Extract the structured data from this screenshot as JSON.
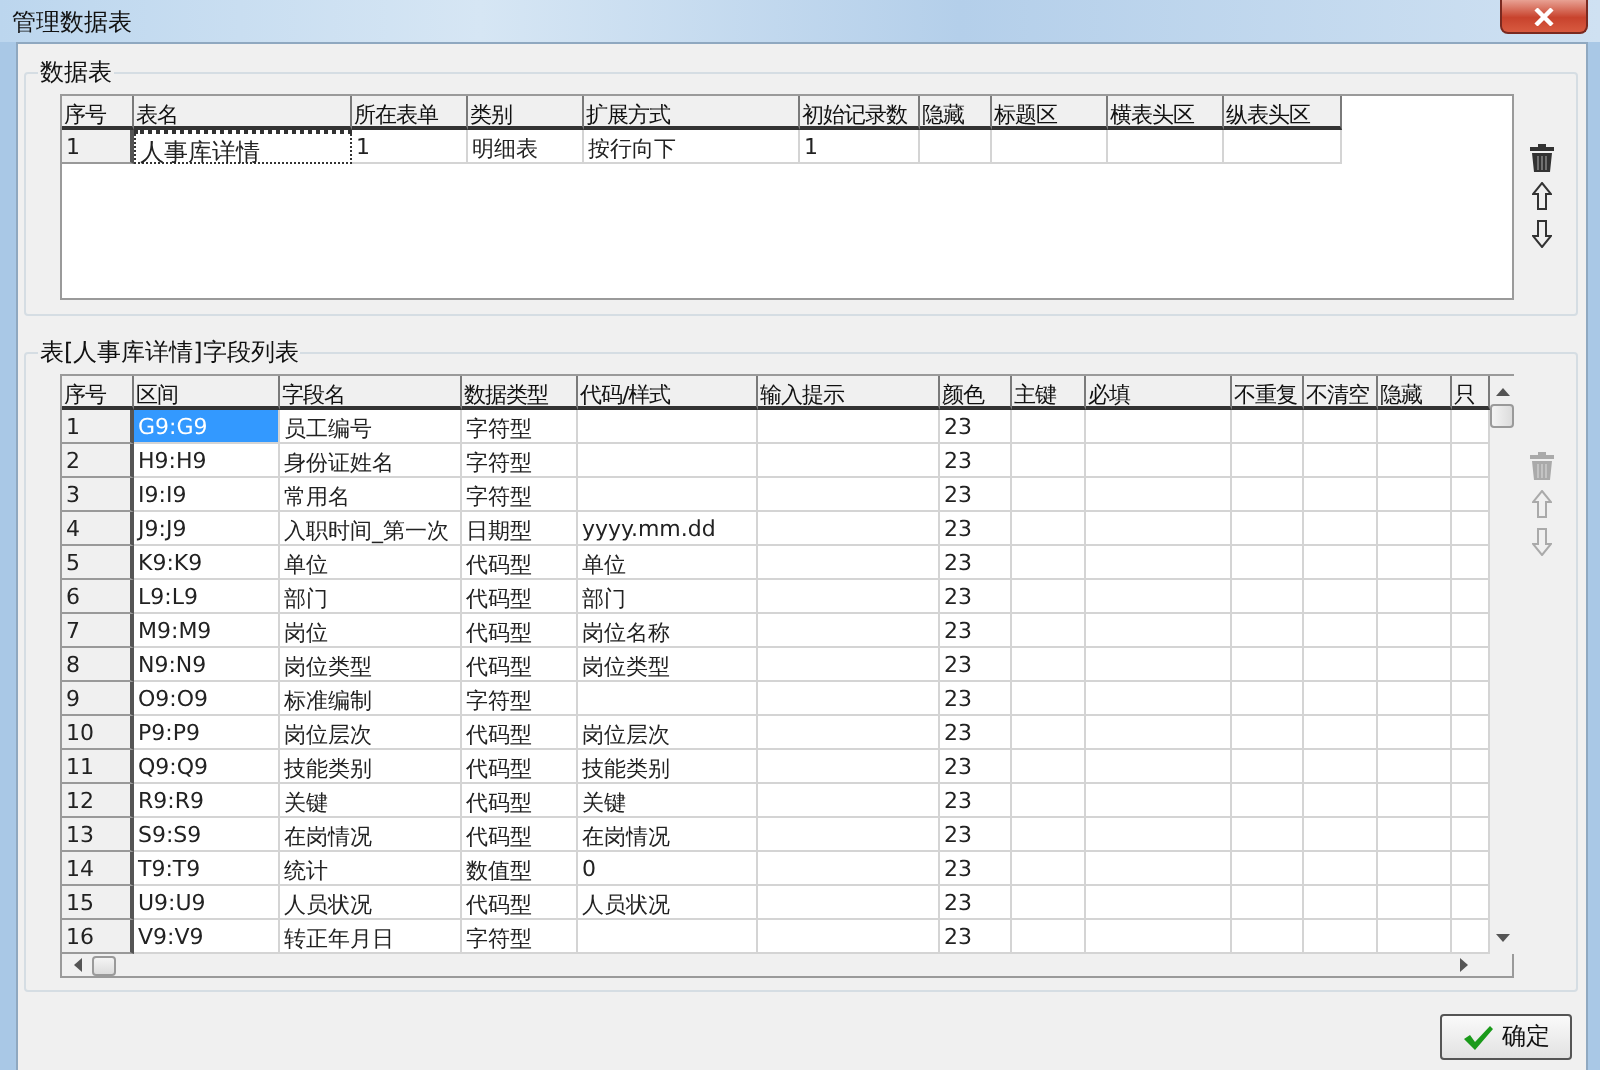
{
  "window": {
    "title": "管理数据表"
  },
  "data_table": {
    "title": "数据表",
    "columns": [
      "序号",
      "表名",
      "所在表单",
      "类别",
      "扩展方式",
      "初始记录数",
      "隐藏",
      "标题区",
      "横表头区",
      "纵表头区"
    ],
    "rows": [
      {
        "no": "1",
        "name": "人事库详情",
        "form": "1",
        "category": "明细表",
        "expand": "按行向下",
        "initial_count": "1",
        "selected": true
      }
    ]
  },
  "data_table_tools": [
    {
      "kind": "delete",
      "disabled": false
    },
    {
      "kind": "up",
      "disabled": false
    },
    {
      "kind": "down",
      "disabled": false
    }
  ],
  "field_table": {
    "title": "表[人事库详情]字段列表",
    "columns": [
      "序号",
      "区间",
      "字段名",
      "数据类型",
      "代码/样式",
      "输入提示",
      "颜色",
      "主键",
      "必填",
      "不重复",
      "不清空",
      "隐藏",
      "只"
    ],
    "rows": [
      {
        "no": "1",
        "range": "G9:G9",
        "name": "员工编号",
        "type": "字符型",
        "color_no": "23",
        "selected": true
      },
      {
        "no": "2",
        "range": "H9:H9",
        "name": "身份证姓名",
        "type": "字符型",
        "color_no": "23",
        "selected": false
      },
      {
        "no": "3",
        "range": "I9:I9",
        "name": "常用名",
        "type": "字符型",
        "color_no": "23",
        "selected": false
      },
      {
        "no": "4",
        "range": "J9:J9",
        "name": "入职时间_第一次",
        "type": "日期型",
        "code": "yyyy.mm.dd",
        "color_no": "23",
        "selected": false
      },
      {
        "no": "5",
        "range": "K9:K9",
        "name": "单位",
        "type": "代码型",
        "code": "单位",
        "color_no": "23",
        "selected": false
      },
      {
        "no": "6",
        "range": "L9:L9",
        "name": "部门",
        "type": "代码型",
        "code": "部门",
        "color_no": "23",
        "selected": false
      },
      {
        "no": "7",
        "range": "M9:M9",
        "name": "岗位",
        "type": "代码型",
        "code": "岗位名称",
        "color_no": "23",
        "selected": false
      },
      {
        "no": "8",
        "range": "N9:N9",
        "name": "岗位类型",
        "type": "代码型",
        "code": "岗位类型",
        "color_no": "23",
        "selected": false
      },
      {
        "no": "9",
        "range": "O9:O9",
        "name": "标准编制",
        "type": "字符型",
        "color_no": "23",
        "selected": false
      },
      {
        "no": "10",
        "range": "P9:P9",
        "name": "岗位层次",
        "type": "代码型",
        "code": "岗位层次",
        "color_no": "23",
        "selected": false
      },
      {
        "no": "11",
        "range": "Q9:Q9",
        "name": "技能类别",
        "type": "代码型",
        "code": "技能类别",
        "color_no": "23",
        "selected": false
      },
      {
        "no": "12",
        "range": "R9:R9",
        "name": "关键",
        "type": "代码型",
        "code": "关键",
        "color_no": "23",
        "selected": false
      },
      {
        "no": "13",
        "range": "S9:S9",
        "name": "在岗情况",
        "type": "代码型",
        "code": "在岗情况",
        "color_no": "23",
        "selected": false
      },
      {
        "no": "14",
        "range": "T9:T9",
        "name": "统计",
        "type": "数值型",
        "code": "0",
        "color_no": "23",
        "selected": false
      },
      {
        "no": "15",
        "range": "U9:U9",
        "name": "人员状况",
        "type": "代码型",
        "code": "人员状况",
        "color_no": "23",
        "selected": false
      },
      {
        "no": "16",
        "range": "V9:V9",
        "name": "转正年月日",
        "type": "字符型",
        "color_no": "23",
        "selected": false
      }
    ]
  },
  "field_table_tools": [
    {
      "kind": "delete",
      "disabled": true
    },
    {
      "kind": "up",
      "disabled": true
    },
    {
      "kind": "down",
      "disabled": true
    }
  ],
  "buttons": [
    {
      "label": "确定"
    }
  ]
}
